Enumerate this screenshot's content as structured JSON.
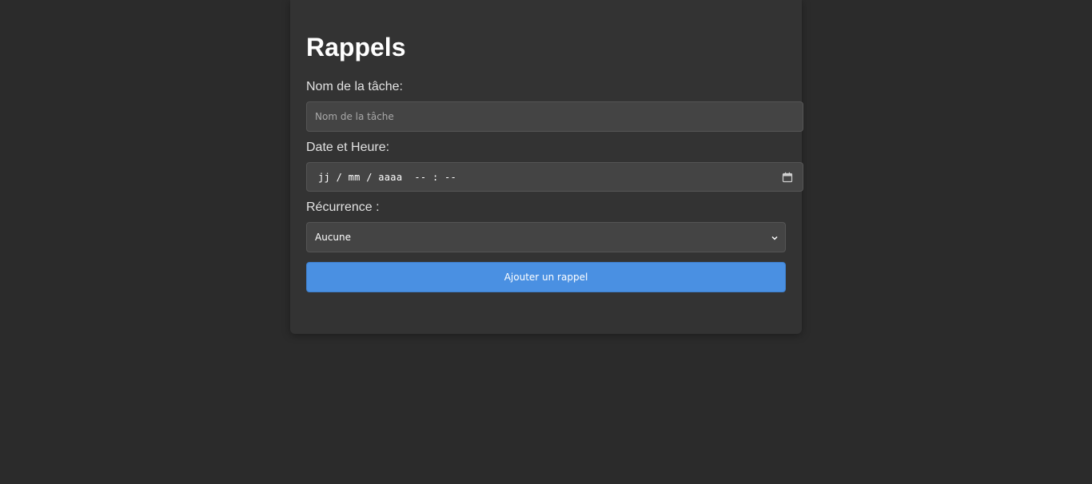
{
  "form": {
    "title": "Rappels",
    "task_label": "Nom de la tâche:",
    "task_placeholder": "Nom de la tâche",
    "task_value": "",
    "datetime_label": "Date et Heure:",
    "datetime_placeholder": "jj / mm / aaaa  -- : --",
    "datetime_icon": "calendar-icon",
    "recurrence_label": "Récurrence :",
    "recurrence_selected": "Aucune",
    "recurrence_icon": "chevron-down-icon",
    "submit_label": "Ajouter un rappel"
  },
  "colors": {
    "background": "#2b2b2b",
    "card": "#333333",
    "field": "#444444",
    "accent": "#4a90e2"
  }
}
